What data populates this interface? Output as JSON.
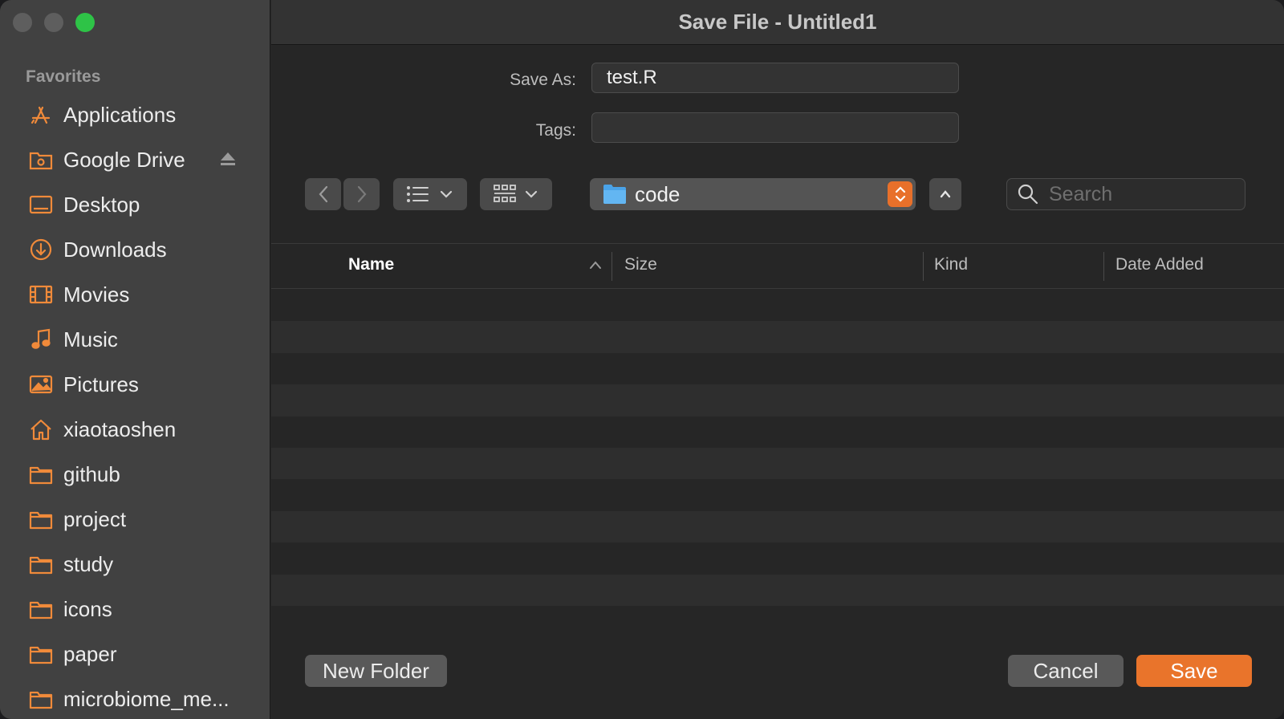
{
  "window": {
    "title": "Save File - Untitled1"
  },
  "sidebar": {
    "heading": "Favorites",
    "items": [
      {
        "label": "Applications",
        "icon": "applications-icon"
      },
      {
        "label": "Google Drive",
        "icon": "drive-folder-icon",
        "ejectable": true
      },
      {
        "label": "Desktop",
        "icon": "desktop-icon"
      },
      {
        "label": "Downloads",
        "icon": "downloads-icon"
      },
      {
        "label": "Movies",
        "icon": "movies-icon"
      },
      {
        "label": "Music",
        "icon": "music-icon"
      },
      {
        "label": "Pictures",
        "icon": "pictures-icon"
      },
      {
        "label": "xiaotaoshen",
        "icon": "home-icon"
      },
      {
        "label": "github",
        "icon": "folder-icon"
      },
      {
        "label": "project",
        "icon": "folder-icon"
      },
      {
        "label": "study",
        "icon": "folder-icon"
      },
      {
        "label": "icons",
        "icon": "folder-icon"
      },
      {
        "label": "paper",
        "icon": "folder-icon"
      },
      {
        "label": "microbiome_me...",
        "icon": "folder-icon"
      }
    ]
  },
  "form": {
    "save_as_label": "Save As:",
    "save_as_value": "test.R",
    "tags_label": "Tags:",
    "tags_value": ""
  },
  "toolbar": {
    "location": "code",
    "search_placeholder": "Search"
  },
  "list": {
    "columns": [
      "Name",
      "Size",
      "Kind",
      "Date Added"
    ],
    "sort_column": "Name",
    "rows": []
  },
  "footer": {
    "new_folder_label": "New Folder",
    "cancel_label": "Cancel",
    "save_label": "Save"
  },
  "colors": {
    "accent": "#e9742b",
    "sidebar_icon": "#f08a3a",
    "folder_blue": "#4aa3e8",
    "zoom_green": "#2ec347"
  }
}
